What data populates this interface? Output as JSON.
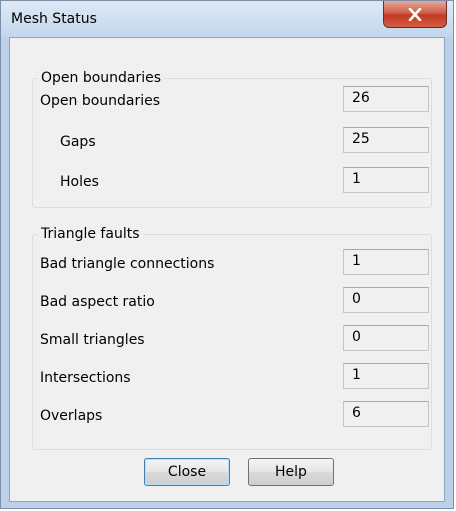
{
  "window": {
    "title": "Mesh Status",
    "close_icon": "close-icon"
  },
  "open_boundaries": {
    "legend": "Open boundaries",
    "rows": [
      {
        "label": "Open boundaries",
        "value": "26"
      },
      {
        "label": "Gaps",
        "value": "25"
      },
      {
        "label": "Holes",
        "value": "1"
      }
    ]
  },
  "triangle_faults": {
    "legend": "Triangle faults",
    "rows": [
      {
        "label": "Bad triangle connections",
        "value": "1"
      },
      {
        "label": "Bad aspect ratio",
        "value": "0"
      },
      {
        "label": "Small triangles",
        "value": "0"
      },
      {
        "label": "Intersections",
        "value": "1"
      },
      {
        "label": "Overlaps",
        "value": "6"
      }
    ]
  },
  "buttons": {
    "close_label": "Close",
    "help_label": "Help"
  }
}
